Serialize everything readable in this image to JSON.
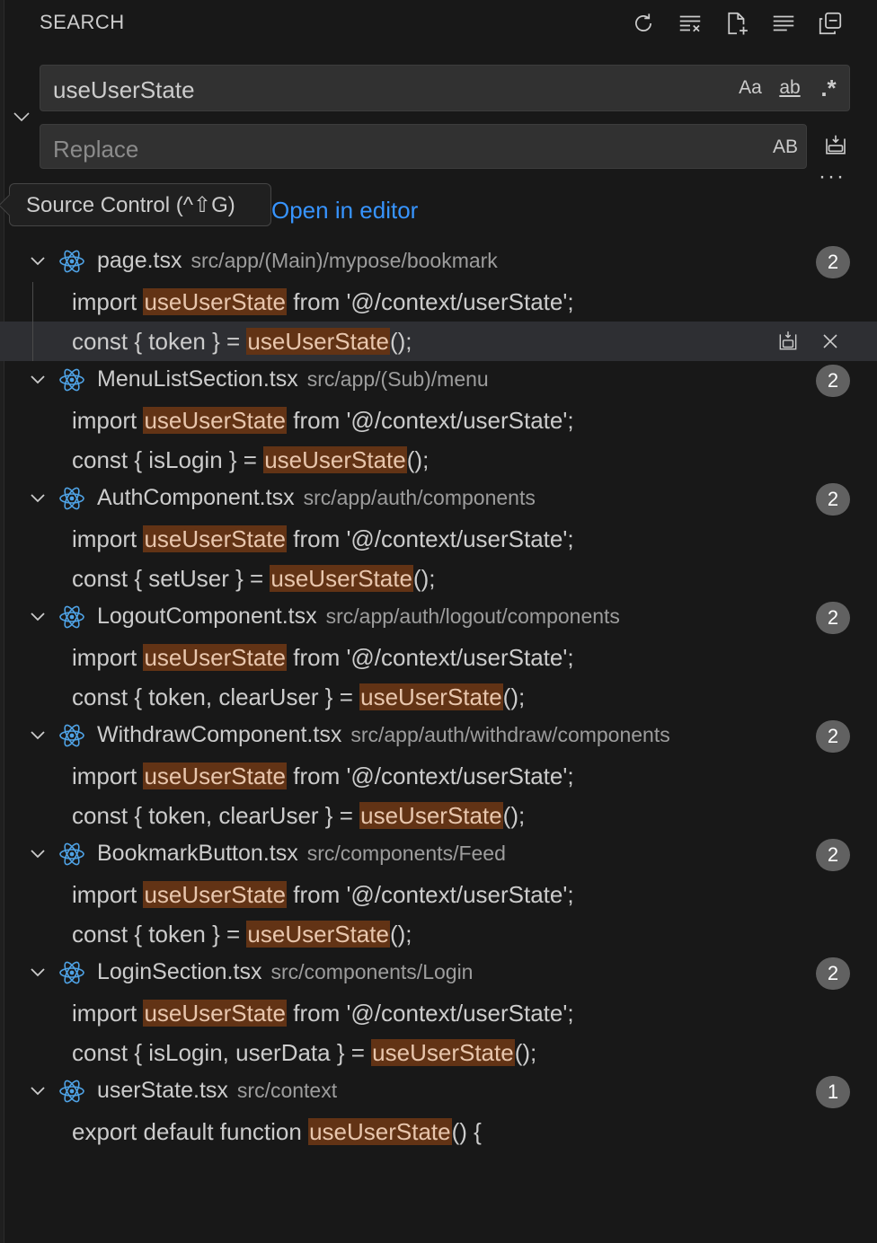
{
  "header": {
    "title": "SEARCH",
    "actions": [
      "refresh-icon",
      "clear-results-icon",
      "new-search-editor-icon",
      "collapse-all-icon",
      "view-as-tree-icon"
    ]
  },
  "search": {
    "value": "useUserState",
    "match_case_label": "Aa",
    "whole_word_label": "ab",
    "regex_label": ".*"
  },
  "replace": {
    "placeholder": "Replace",
    "preserve_case_label": "AB"
  },
  "more_options": "···",
  "tooltip": {
    "text": "Source Control (^⇧G)"
  },
  "open_in_editor": "Open in editor",
  "term": "useUserState",
  "colors": {
    "match_bg": "#623315",
    "link": "#3794ff",
    "badge": "#616161"
  },
  "results": [
    {
      "file": "page.tsx",
      "path": "src/app/(Main)/mypose/bookmark",
      "count": "2",
      "matches": [
        {
          "pre": "import ",
          "post": " from '@/context/userState';"
        },
        {
          "pre": "const { token } = ",
          "post": "();"
        }
      ]
    },
    {
      "file": "MenuListSection.tsx",
      "path": "src/app/(Sub)/menu",
      "count": "2",
      "matches": [
        {
          "pre": "import ",
          "post": " from '@/context/userState';"
        },
        {
          "pre": "const { isLogin } = ",
          "post": "();"
        }
      ]
    },
    {
      "file": "AuthComponent.tsx",
      "path": "src/app/auth/components",
      "count": "2",
      "matches": [
        {
          "pre": "import ",
          "post": " from '@/context/userState';"
        },
        {
          "pre": "const { setUser } = ",
          "post": "();"
        }
      ]
    },
    {
      "file": "LogoutComponent.tsx",
      "path": "src/app/auth/logout/components",
      "count": "2",
      "matches": [
        {
          "pre": "import ",
          "post": " from '@/context/userState';"
        },
        {
          "pre": "const { token, clearUser } = ",
          "post": "();"
        }
      ]
    },
    {
      "file": "WithdrawComponent.tsx",
      "path": "src/app/auth/withdraw/components",
      "count": "2",
      "matches": [
        {
          "pre": "import ",
          "post": " from '@/context/userState';"
        },
        {
          "pre": "const { token, clearUser } = ",
          "post": "();"
        }
      ]
    },
    {
      "file": "BookmarkButton.tsx",
      "path": "src/components/Feed",
      "count": "2",
      "matches": [
        {
          "pre": "import ",
          "post": " from '@/context/userState';"
        },
        {
          "pre": "const { token } = ",
          "post": "();"
        }
      ]
    },
    {
      "file": "LoginSection.tsx",
      "path": "src/components/Login",
      "count": "2",
      "matches": [
        {
          "pre": "import ",
          "post": " from '@/context/userState';"
        },
        {
          "pre": "const { isLogin, userData } = ",
          "post": "();"
        }
      ]
    },
    {
      "file": "userState.tsx",
      "path": "src/context",
      "count": "1",
      "matches": [
        {
          "pre": "export default function ",
          "post": "() {"
        }
      ]
    }
  ]
}
